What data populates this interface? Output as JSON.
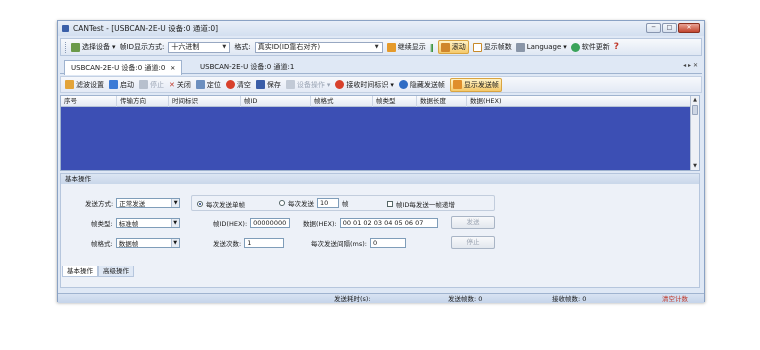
{
  "window": {
    "title": "CANTest - [USBCAN-2E-U 设备:0 通道:0]",
    "controls": {
      "minimize": "─",
      "maximize": "□",
      "close": "✕"
    }
  },
  "toolbar1": {
    "select_device": "选择设备",
    "id_display_label": "帧ID显示方式:",
    "id_display_value": "十六进制",
    "format_label": "格式:",
    "format_value": "真实ID(ID靠右对齐)",
    "continue_display": "继续显示",
    "scroll": "滚动",
    "show_frame_count": "显示帧数",
    "language": "Language",
    "software_update": "软件更新"
  },
  "tabs": [
    {
      "label": "USBCAN-2E-U 设备:0 通道:0",
      "close": "✕"
    },
    {
      "label": "USBCAN-2E-U 设备:0 通道:1"
    }
  ],
  "tab_controls": "◂ ▸ ✕",
  "toolbar2": {
    "filter_settings": "滤波设置",
    "start": "启动",
    "stop": "停止",
    "close": "关闭",
    "locate": "定位",
    "clear": "清空",
    "save": "保存",
    "device_ops": "设备操作",
    "recv_time_mark": "接收时间标识",
    "hide_send_frames": "隐藏发送帧",
    "show_send_frames": "显示发送帧"
  },
  "grid": {
    "columns": [
      "序号",
      "传输方向",
      "时间标识",
      "帧ID",
      "帧格式",
      "帧类型",
      "数据长度",
      "数据(HEX)"
    ]
  },
  "panel": {
    "title": "基本操作",
    "send_mode_label": "发送方式:",
    "send_mode_value": "正常发送",
    "radio_single": "每次发送单帧",
    "radio_multi": "每次发送",
    "multi_count": "10",
    "frame_unit": "帧",
    "id_increment": "帧ID每发送一帧递增",
    "frame_type_label": "帧类型:",
    "frame_type_value": "标准帧",
    "frame_id_label": "帧ID(HEX):",
    "frame_id_value": "00000000",
    "data_label": "数据(HEX):",
    "data_value": "00 01 02 03 04 05 06 07",
    "send_button": "发送",
    "frame_format_label": "帧格式:",
    "frame_format_value": "数据帧",
    "send_count_label": "发送次数:",
    "send_count_value": "1",
    "send_interval_label": "每次发送间隔(ms):",
    "send_interval_value": "0",
    "stop_button": "停止"
  },
  "subtabs": [
    "基本操作",
    "高级操作"
  ],
  "status": {
    "send_time": "发送耗时(s):",
    "send_count": "发送帧数: 0",
    "recv_count": "接收帧数: 0",
    "clear_count": "清空计数"
  },
  "colors": {
    "grid_bg": "#3c4fb4",
    "window_bg": "#dfe8f5",
    "clear_count": "#c0392b"
  }
}
